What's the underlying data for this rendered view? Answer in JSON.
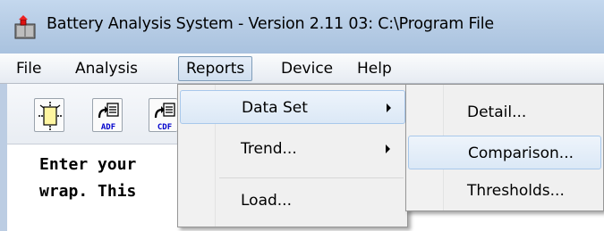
{
  "window": {
    "title": "Battery Analysis System - Version 2.11 03: C:\\Program File"
  },
  "menubar": {
    "items": [
      {
        "label": "File"
      },
      {
        "label": "Analysis"
      },
      {
        "label": "Reports"
      },
      {
        "label": "Device"
      },
      {
        "label": "Help"
      }
    ],
    "active": "Reports"
  },
  "toolbar": {
    "buttons": [
      {
        "icon": "new-document-icon"
      },
      {
        "icon": "adf-export-icon",
        "caption": "ADF"
      },
      {
        "icon": "cdf-export-icon",
        "caption": "CDF"
      }
    ]
  },
  "editor": {
    "lines": [
      "Enter your",
      "wrap. This"
    ]
  },
  "reports_menu": {
    "items": [
      {
        "label": "Data Set",
        "has_submenu": true,
        "highlighted": true
      },
      {
        "label": "Trend...",
        "has_submenu": true,
        "highlighted": false
      },
      {
        "label": "Load...",
        "has_submenu": false,
        "highlighted": false
      }
    ]
  },
  "data_set_submenu": {
    "items": [
      {
        "label": "Detail...",
        "highlighted": false
      },
      {
        "label": "Comparison...",
        "highlighted": true
      },
      {
        "label": "Thresholds...",
        "highlighted": false
      }
    ]
  },
  "colors": {
    "titlebar": "#b5cbe4",
    "menu_highlight_border": "#a8c8eb",
    "menu_background": "#f0f0f0"
  }
}
